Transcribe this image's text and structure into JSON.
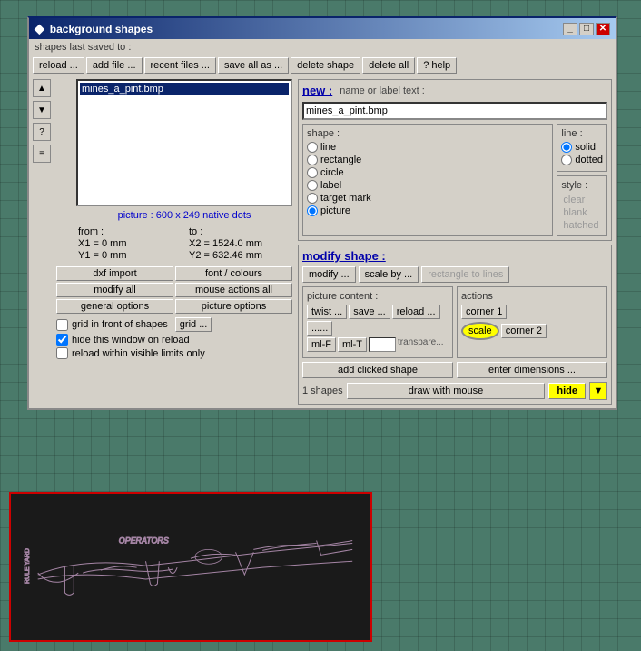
{
  "window": {
    "title": "background  shapes",
    "icon": "◆"
  },
  "toolbar": {
    "saved_label": "shapes last saved to :",
    "buttons": {
      "reload": "reload ...",
      "add_file": "add file ...",
      "recent_files": "recent files ...",
      "save_all": "save  all  as ...",
      "delete_shape": "delete shape",
      "delete_all": "delete all",
      "help": "? help"
    }
  },
  "file_list": {
    "items": [
      "mines_a_pint.bmp"
    ]
  },
  "info": {
    "picture_size": "picture : 600 x 249  native  dots",
    "from_label": "from :",
    "to_label": "to :",
    "x1": "X1 = 0  mm",
    "y1": "Y1 = 0  mm",
    "x2": "X2 = 1524.0  mm",
    "y2": "Y2 = 632.46  mm"
  },
  "action_buttons": {
    "dxf_import": "dxf  import",
    "font_colours": "font / colours",
    "modify_all": "modify  all",
    "mouse_actions_all": "mouse actions all",
    "general_options": "general options",
    "picture_options": "picture  options"
  },
  "checkboxes": {
    "grid_front": "grid in front of shapes",
    "grid_btn": "grid ...",
    "hide_window": "hide this window on reload",
    "reload_visible": "reload within visible limits only"
  },
  "new_section": {
    "label": "new :",
    "name_label": "name or label text :",
    "name_value": "mines_a_pint.bmp"
  },
  "shape": {
    "label": "shape :",
    "options": [
      "line",
      "rectangle",
      "circle",
      "label",
      "target mark",
      "picture"
    ],
    "selected": "picture"
  },
  "line": {
    "label": "line :",
    "options": [
      "solid",
      "dotted"
    ],
    "selected": "solid"
  },
  "style": {
    "label": "style :",
    "options": [
      "clear",
      "blank",
      "hatched"
    ]
  },
  "modify_section": {
    "label": "modify  shape :",
    "modify_btn": "modify ...",
    "scale_by_btn": "scale by ...",
    "rect_to_lines_btn": "rectangle  to  lines"
  },
  "picture_content": {
    "label": "picture  content :",
    "twist_btn": "twist ...",
    "save_btn": "save ...",
    "reload_btn": "reload ...",
    "dots_btn": "......",
    "ml_f": "ml-F",
    "ml_t": "ml-T",
    "transparent_label": "transpare..."
  },
  "mouse_actions": {
    "label": "actions",
    "corner1_btn": "corner 1",
    "scale_btn": "scale",
    "corner2_btn": "corner 2"
  },
  "bottom": {
    "add_clicked": "add clicked shape",
    "enter_dimensions": "enter  dimensions ...",
    "shapes_count": "1  shapes",
    "draw_with_mouse": "draw with mouse",
    "hide_btn": "hide"
  }
}
